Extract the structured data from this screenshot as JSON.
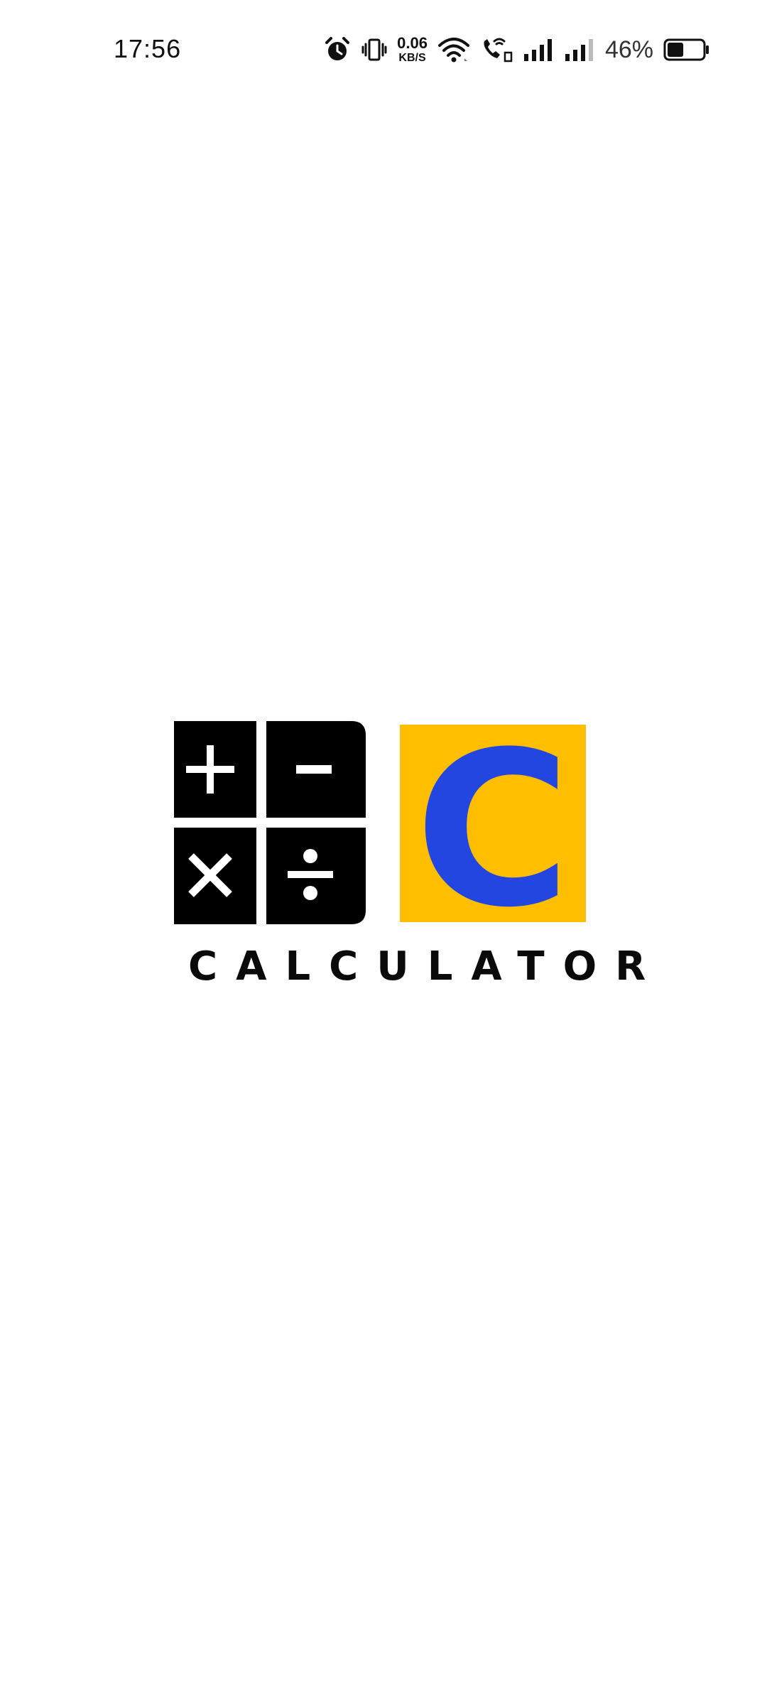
{
  "status_bar": {
    "time": "17:56",
    "net_speed_value": "0.06",
    "net_speed_unit": "KB/S",
    "battery_percent": "46%",
    "battery_level": 0.46,
    "icons": [
      "alarm-icon",
      "vibrate-icon",
      "wifi-icon",
      "wifi-calling-icon",
      "signal-1-icon",
      "signal-2-icon",
      "battery-icon"
    ]
  },
  "splash": {
    "app_name": "CALCULATOR",
    "logo_letter": "C",
    "colors": {
      "keys": "#000000",
      "badge_background": "#FFBE00",
      "badge_letter": "#2346E0",
      "text": "#0A0A0A",
      "background": "#FFFFFF"
    }
  }
}
